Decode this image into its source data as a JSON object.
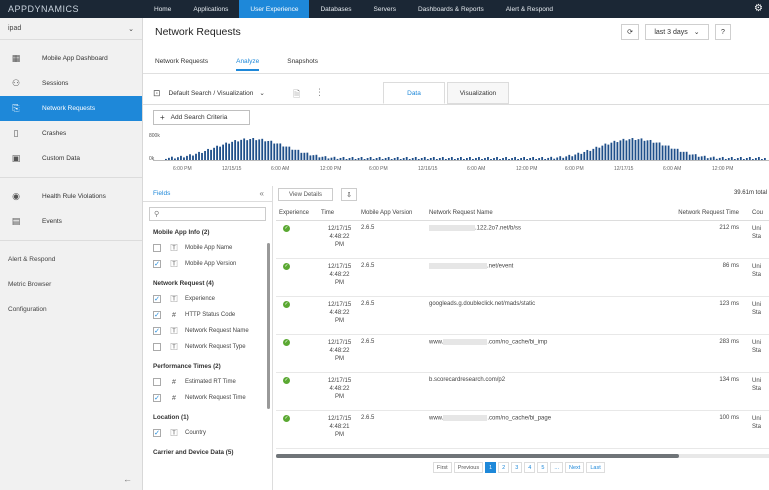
{
  "brand": {
    "logo_text": "APPDYNAMICS"
  },
  "topnav": {
    "items": [
      {
        "label": "Home"
      },
      {
        "label": "Applications"
      },
      {
        "label": "User Experience"
      },
      {
        "label": "Databases"
      },
      {
        "label": "Servers"
      },
      {
        "label": "Dashboards & Reports"
      },
      {
        "label": "Alert & Respond"
      }
    ],
    "active_index": 2
  },
  "sidebar": {
    "app_name": "ipad",
    "items": [
      {
        "label": "Mobile App Dashboard",
        "icon": "dashboard-icon"
      },
      {
        "label": "Sessions",
        "icon": "sessions-icon"
      },
      {
        "label": "Network Requests",
        "icon": "network-request-icon"
      },
      {
        "label": "Crashes",
        "icon": "crash-icon"
      },
      {
        "label": "Custom Data",
        "icon": "custom-data-icon"
      },
      {
        "label": "Health Rule Violations",
        "icon": "health-rule-icon"
      },
      {
        "label": "Events",
        "icon": "events-icon"
      }
    ],
    "active_index": 2,
    "links": [
      {
        "label": "Alert & Respond"
      },
      {
        "label": "Metric Browser"
      },
      {
        "label": "Configuration"
      }
    ]
  },
  "header": {
    "title": "Network Requests",
    "time_range": "last 3 days",
    "help": "?"
  },
  "subtabs": {
    "items": [
      {
        "label": "Network Requests"
      },
      {
        "label": "Analyze"
      },
      {
        "label": "Snapshots"
      }
    ],
    "active_index": 1
  },
  "search": {
    "default_label": "Default Search / Visualization",
    "add_criteria_label": "Add Search Criteria"
  },
  "view_tabs": {
    "items": [
      {
        "label": "Data"
      },
      {
        "label": "Visualization"
      }
    ],
    "active_index": 0
  },
  "timeline": {
    "y_top_label": "800k",
    "y_bottom_label": "0k",
    "ticks": [
      "6:00 PM",
      "12/15/15",
      "6:00 AM",
      "12:00 PM",
      "6:00 PM",
      "12/16/15",
      "6:00 AM",
      "12:00 PM",
      "6:00 PM",
      "12/17/15",
      "6:00 AM",
      "12:00 PM"
    ]
  },
  "fields_panel": {
    "title": "Fields",
    "search_icon": "search-icon",
    "groups": [
      {
        "label": "Mobile App Info (2)",
        "items": [
          {
            "label": "Mobile App Name",
            "type": "T",
            "checked": false
          },
          {
            "label": "Mobile App Version",
            "type": "T",
            "checked": true
          }
        ]
      },
      {
        "label": "Network Request (4)",
        "items": [
          {
            "label": "Experience",
            "type": "T",
            "checked": true
          },
          {
            "label": "HTTP Status Code",
            "type": "#",
            "checked": true
          },
          {
            "label": "Network Request Name",
            "type": "T",
            "checked": true
          },
          {
            "label": "Network Request Type",
            "type": "T",
            "checked": false
          }
        ]
      },
      {
        "label": "Performance Times (2)",
        "items": [
          {
            "label": "Estimated RT Time",
            "type": "#",
            "checked": false
          },
          {
            "label": "Network Request Time",
            "type": "#",
            "checked": true
          }
        ]
      },
      {
        "label": "Location (1)",
        "items": [
          {
            "label": "Country",
            "type": "T",
            "checked": true
          }
        ]
      },
      {
        "label": "Carrier and Device Data (5)",
        "items": []
      }
    ]
  },
  "table_toolbar": {
    "view_details_label": "View Details",
    "total_label": "39.61m total"
  },
  "table": {
    "columns": [
      "Experience",
      "Time",
      "Mobile App Version",
      "Network Request Name",
      "Network Request Time",
      "Cou"
    ],
    "rows": [
      {
        "time": [
          "12/17/15",
          "4:48:22",
          "PM"
        ],
        "version": "2.6.5",
        "name_prefix": "",
        "name": ".122.2o7.net/b/ss",
        "rt": "212 ms",
        "country": "Uni Sta"
      },
      {
        "time": [
          "12/17/15",
          "4:48:22",
          "PM"
        ],
        "version": "2.6.5",
        "name_prefix": "",
        "name": ".net/event",
        "rt": "86 ms",
        "country": "Uni Sta"
      },
      {
        "time": [
          "12/17/15",
          "4:48:22",
          "PM"
        ],
        "version": "2.6.5",
        "name_prefix": "",
        "name": "googleads.g.doubleclick.net/mads/static",
        "rt": "123 ms",
        "country": "Uni Sta"
      },
      {
        "time": [
          "12/17/15",
          "4:48:22",
          "PM"
        ],
        "version": "2.6.5",
        "name_prefix": "www.",
        "name": ".com/no_cache/bi_imp",
        "rt": "283 ms",
        "country": "Uni Sta"
      },
      {
        "time": [
          "12/17/15",
          "4:48:22",
          "PM"
        ],
        "version": "",
        "name_prefix": "",
        "name": "b.scorecardresearch.com/p2",
        "rt": "134 ms",
        "country": "Uni Sta"
      },
      {
        "time": [
          "12/17/15",
          "4:48:21",
          "PM"
        ],
        "version": "2.6.5",
        "name_prefix": "www.",
        "name": ".com/no_cache/bi_page",
        "rt": "100 ms",
        "country": "Uni Sta"
      }
    ]
  },
  "pagination": {
    "first": "First",
    "previous": "Previous",
    "pages": [
      "1",
      "2",
      "3",
      "4",
      "5"
    ],
    "ellipsis": "...",
    "next": "Next",
    "last": "Last",
    "active_index": 0
  },
  "colors": {
    "accent": "#1e88d9",
    "topbar": "#1b2735",
    "ok": "#5aa832",
    "timeline_bar": "#1f4f8a"
  }
}
